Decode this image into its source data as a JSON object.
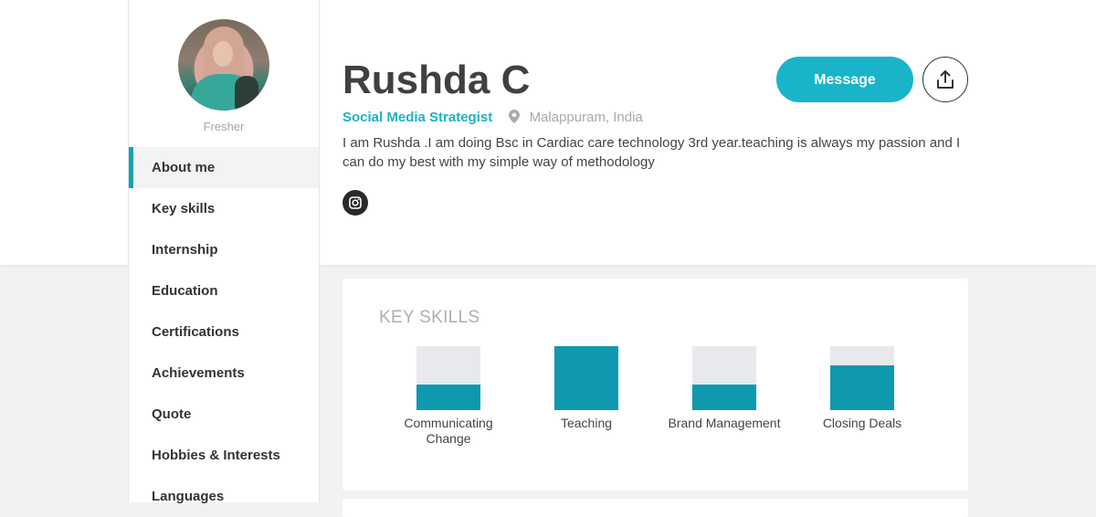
{
  "profile": {
    "name": "Rushda C",
    "level": "Fresher",
    "role": "Social Media Strategist",
    "location": "Malappuram, India",
    "bio": "I am Rushda .I am doing Bsc in Cardiac care technology 3rd year.teaching is always my passion and I can do my best with my simple way of methodology"
  },
  "actions": {
    "message_label": "Message"
  },
  "sidebar": {
    "items": [
      {
        "label": "About me",
        "active": true
      },
      {
        "label": "Key skills"
      },
      {
        "label": "Internship"
      },
      {
        "label": "Education"
      },
      {
        "label": "Certifications"
      },
      {
        "label": "Achievements"
      },
      {
        "label": "Quote"
      },
      {
        "label": "Hobbies & Interests"
      },
      {
        "label": "Languages"
      }
    ]
  },
  "key_skills": {
    "heading": "KEY SKILLS",
    "items": [
      {
        "name": "Communicating Change",
        "level": 0.4
      },
      {
        "name": "Teaching",
        "level": 1.0
      },
      {
        "name": "Brand Management",
        "level": 0.4
      },
      {
        "name": "Closing Deals",
        "level": 0.7
      }
    ]
  },
  "icons": {
    "location": "map-pin-icon",
    "share": "share-upload-icon",
    "social": "instagram-icon"
  },
  "colors": {
    "accent": "#1ab4ca",
    "skill_fill": "#0f99ae",
    "skill_empty": "#e8e9ec",
    "nav_active_bar": "#16a3b8"
  }
}
